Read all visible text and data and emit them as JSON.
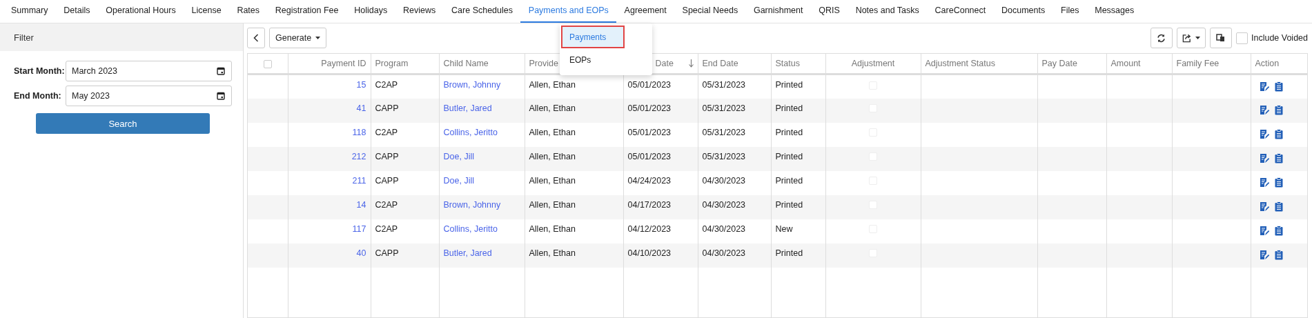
{
  "tabs": [
    {
      "label": "Summary",
      "selected": false
    },
    {
      "label": "Details",
      "selected": false
    },
    {
      "label": "Operational Hours",
      "selected": false
    },
    {
      "label": "License",
      "selected": false
    },
    {
      "label": "Rates",
      "selected": false
    },
    {
      "label": "Registration Fee",
      "selected": false
    },
    {
      "label": "Holidays",
      "selected": false
    },
    {
      "label": "Reviews",
      "selected": false
    },
    {
      "label": "Care Schedules",
      "selected": false
    },
    {
      "label": "Payments and EOPs",
      "selected": true
    },
    {
      "label": "Agreement",
      "selected": false
    },
    {
      "label": "Special Needs",
      "selected": false
    },
    {
      "label": "Garnishment",
      "selected": false
    },
    {
      "label": "QRIS",
      "selected": false
    },
    {
      "label": "Notes and Tasks",
      "selected": false
    },
    {
      "label": "CareConnect",
      "selected": false
    },
    {
      "label": "Documents",
      "selected": false
    },
    {
      "label": "Files",
      "selected": false
    },
    {
      "label": "Messages",
      "selected": false
    }
  ],
  "dropdown_menu": {
    "items": [
      {
        "label": "Payments",
        "selected": true
      },
      {
        "label": "EOPs",
        "selected": false
      }
    ]
  },
  "filter": {
    "title": "Filter",
    "fields": [
      {
        "label": "Start Month:",
        "value": "March 2023"
      },
      {
        "label": "End Month:",
        "value": "May 2023"
      }
    ],
    "search_button": "Search"
  },
  "toolbar": {
    "generate_button": "Generate",
    "include_voided": {
      "label": "Include Voided",
      "checked": false
    }
  },
  "table": {
    "select_all_checked": false,
    "columns": [
      {
        "label": "Payment ID",
        "sorted": false
      },
      {
        "label": "Program",
        "sorted": false
      },
      {
        "label": "Child Name",
        "sorted": false
      },
      {
        "label": "Provide",
        "sorted": false
      },
      {
        "label": "Date",
        "sorted": true
      },
      {
        "label": "End Date",
        "sorted": false
      },
      {
        "label": "Status",
        "sorted": false
      },
      {
        "label": "Adjustment",
        "sorted": false
      },
      {
        "label": "Adjustment Status",
        "sorted": false
      },
      {
        "label": "Pay Date",
        "sorted": false
      },
      {
        "label": "Amount",
        "sorted": false
      },
      {
        "label": "Family Fee",
        "sorted": false
      },
      {
        "label": "Action",
        "sorted": false
      }
    ],
    "rows": [
      {
        "payment_id": "15",
        "program": "C2AP",
        "child_name": "Brown, Johnny",
        "provider": "Allen, Ethan",
        "start_date": "05/01/2023",
        "end_date": "05/31/2023",
        "status": "Printed",
        "adjustment_checked": false
      },
      {
        "payment_id": "41",
        "program": "CAPP",
        "child_name": "Butler, Jared",
        "provider": "Allen, Ethan",
        "start_date": "05/01/2023",
        "end_date": "05/31/2023",
        "status": "Printed",
        "adjustment_checked": false
      },
      {
        "payment_id": "118",
        "program": "C2AP",
        "child_name": "Collins, Jeritto",
        "provider": "Allen, Ethan",
        "start_date": "05/01/2023",
        "end_date": "05/31/2023",
        "status": "Printed",
        "adjustment_checked": false
      },
      {
        "payment_id": "212",
        "program": "CAPP",
        "child_name": "Doe, Jill",
        "provider": "Allen, Ethan",
        "start_date": "05/01/2023",
        "end_date": "05/31/2023",
        "status": "Printed",
        "adjustment_checked": false
      },
      {
        "payment_id": "211",
        "program": "CAPP",
        "child_name": "Doe, Jill",
        "provider": "Allen, Ethan",
        "start_date": "04/24/2023",
        "end_date": "04/30/2023",
        "status": "Printed",
        "adjustment_checked": false
      },
      {
        "payment_id": "14",
        "program": "C2AP",
        "child_name": "Brown, Johnny",
        "provider": "Allen, Ethan",
        "start_date": "04/17/2023",
        "end_date": "04/30/2023",
        "status": "Printed",
        "adjustment_checked": false
      },
      {
        "payment_id": "117",
        "program": "C2AP",
        "child_name": "Collins, Jeritto",
        "provider": "Allen, Ethan",
        "start_date": "04/12/2023",
        "end_date": "04/30/2023",
        "status": "New",
        "adjustment_checked": false
      },
      {
        "payment_id": "40",
        "program": "CAPP",
        "child_name": "Butler, Jared",
        "provider": "Allen, Ethan",
        "start_date": "04/10/2023",
        "end_date": "04/30/2023",
        "status": "Printed",
        "adjustment_checked": false
      }
    ]
  }
}
